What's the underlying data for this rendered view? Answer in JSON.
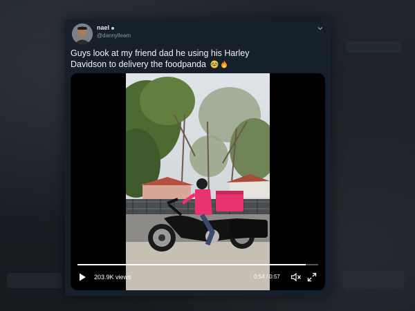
{
  "tweet": {
    "display_name": "nael",
    "handle": "@dannylleam",
    "text_line1": "Guys look at my friend dad he using his Harley",
    "text_line2": "Davidson to delivery the  foodpanda",
    "emojis": [
      "face-with-tears-of-joy-icon",
      "fire-icon"
    ]
  },
  "video": {
    "views_count": "203.9K",
    "views_label": "views",
    "time_current": "0:54",
    "time_separator": "/",
    "time_total": "0:57",
    "progress_fraction": 0.947
  },
  "colors": {
    "card_bg": "#15202b",
    "delivery_box": "#e8336e",
    "text_primary": "#f1f3f4",
    "text_secondary": "#8b98a5"
  }
}
